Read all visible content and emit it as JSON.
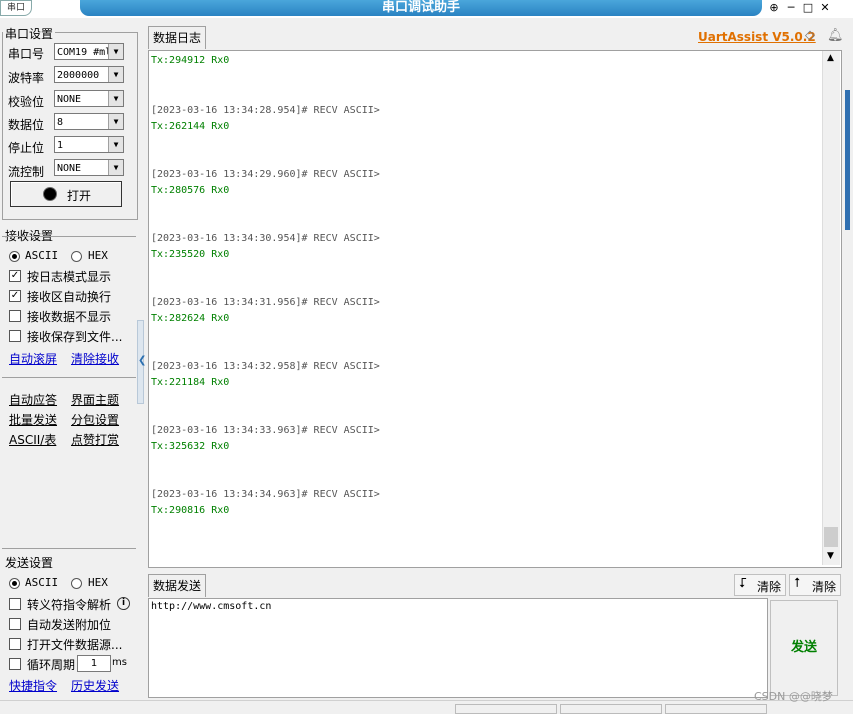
{
  "window": {
    "title": "串口调试助手",
    "app_icon_label": "串口"
  },
  "serial": {
    "section_title": "串口设置",
    "port_label": "串口号",
    "port_value": "COM19 #ml",
    "baud_label": "波特率",
    "baud_value": "2000000",
    "parity_label": "校验位",
    "parity_value": "NONE",
    "databits_label": "数据位",
    "databits_value": "8",
    "stopbits_label": "停止位",
    "stopbits_value": "1",
    "flow_label": "流控制",
    "flow_value": "NONE",
    "open_button": "打开"
  },
  "receive": {
    "section_title": "接收设置",
    "ascii": "ASCII",
    "hex": "HEX",
    "opt_log_mode": "按日志模式显示",
    "opt_auto_wrap": "接收区自动换行",
    "opt_hide": "接收数据不显示",
    "opt_save_file": "接收保存到文件...",
    "auto_scroll": "自动滚屏",
    "clear_recv": "清除接收"
  },
  "tools": {
    "auto_reply": "自动应答",
    "ui_theme": "界面主题",
    "batch_send": "批量发送",
    "packet_settings": "分包设置",
    "ascii_table": "ASCII/表",
    "donate": "点赞打赏"
  },
  "send_settings": {
    "section_title": "发送设置",
    "ascii": "ASCII",
    "hex": "HEX",
    "opt_escape": "转义符指令解析",
    "opt_append": "自动发送附加位",
    "opt_open_file": "打开文件数据源...",
    "opt_cycle": "循环周期",
    "cycle_value": "1",
    "cycle_unit": "ms",
    "quick_cmd": "快捷指令",
    "history": "历史发送"
  },
  "log": {
    "tab_label": "数据日志",
    "version": "UartAssist V5.0.2",
    "entries": [
      {
        "head": "",
        "data": "Tx:294912 Rx0"
      },
      {
        "head": "[2023-03-16 13:34:28.954]# RECV ASCII>",
        "data": "Tx:262144 Rx0"
      },
      {
        "head": "[2023-03-16 13:34:29.960]# RECV ASCII>",
        "data": "Tx:280576 Rx0"
      },
      {
        "head": "[2023-03-16 13:34:30.954]# RECV ASCII>",
        "data": "Tx:235520 Rx0"
      },
      {
        "head": "[2023-03-16 13:34:31.956]# RECV ASCII>",
        "data": "Tx:282624 Rx0"
      },
      {
        "head": "[2023-03-16 13:34:32.958]# RECV ASCII>",
        "data": "Tx:221184 Rx0"
      },
      {
        "head": "[2023-03-16 13:34:33.963]# RECV ASCII>",
        "data": "Tx:325632 Rx0"
      },
      {
        "head": "[2023-03-16 13:34:34.963]# RECV ASCII>",
        "data": "Tx:290816 Rx0"
      }
    ]
  },
  "send": {
    "tab_label": "数据发送",
    "clear1": "清除",
    "clear2": "清除",
    "input_value": "http://www.cmsoft.cn",
    "send_button": "发送"
  },
  "watermark": "CSDN @@晓梦"
}
